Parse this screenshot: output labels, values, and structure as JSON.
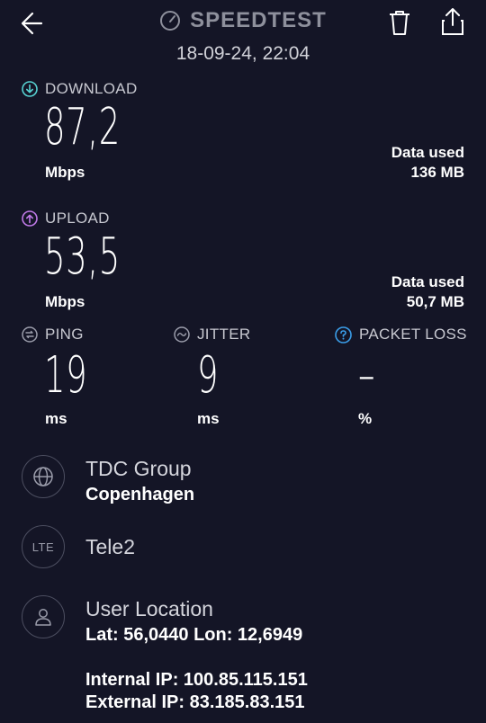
{
  "header": {
    "app_title": "SPEEDTEST",
    "date": "18-09-24, 22:04",
    "back_icon": "arrow-left-icon",
    "trash_icon": "trash-icon",
    "share_icon": "share-icon",
    "brand_icon": "speedometer-icon"
  },
  "download": {
    "label": "DOWNLOAD",
    "value": "87,2",
    "unit": "Mbps",
    "data_used_label": "Data used",
    "data_used_value": "136 MB",
    "icon_color": "#57d3d3"
  },
  "upload": {
    "label": "UPLOAD",
    "value": "53,5",
    "unit": "Mbps",
    "data_used_label": "Data used",
    "data_used_value": "50,7 MB",
    "icon_color": "#c07ae8"
  },
  "ping": {
    "label": "PING",
    "value": "19",
    "unit": "ms"
  },
  "jitter": {
    "label": "JITTER",
    "value": "9",
    "unit": "ms"
  },
  "packet_loss": {
    "label": "PACKET LOSS",
    "value": "–",
    "unit": "%",
    "icon_color": "#3a9de8"
  },
  "provider": {
    "name": "TDC Group",
    "city": "Copenhagen"
  },
  "network": {
    "badge": "LTE",
    "name": "Tele2"
  },
  "location": {
    "title": "User Location",
    "coords": "Lat: 56,0440 Lon: 12,6949",
    "internal_ip": "Internal IP: 100.85.115.151",
    "external_ip": "External IP: 83.185.83.151"
  }
}
